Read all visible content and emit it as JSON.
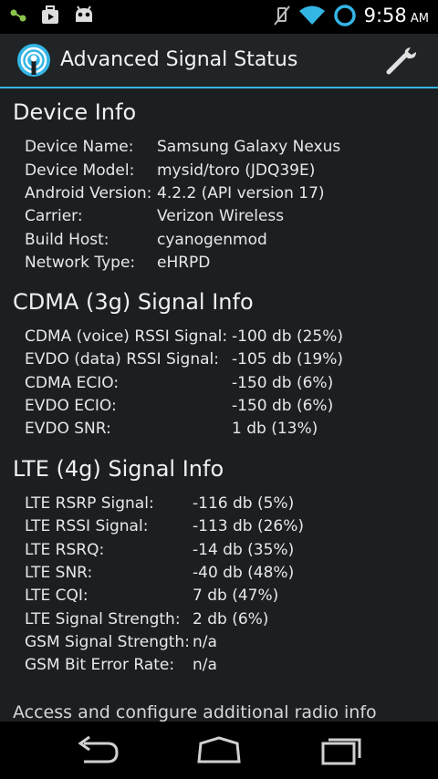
{
  "statusbar": {
    "time": "9:58",
    "ampm": "AM",
    "icons": [
      "voicemail-icon",
      "play-store-icon",
      "android-icon",
      "vibrate-off-icon",
      "wifi-icon",
      "ring-icon",
      "battery-icon"
    ]
  },
  "actionbar": {
    "title": "Advanced Signal Status",
    "settings_icon": "wrench-icon"
  },
  "device_info": {
    "title": "Device Info",
    "rows": [
      {
        "label": "Device Name:",
        "value": "Samsung Galaxy Nexus"
      },
      {
        "label": "Device Model:",
        "value": "mysid/toro (JDQ39E)"
      },
      {
        "label": "Android Version:",
        "value": "4.2.2 (API version 17)"
      },
      {
        "label": "Carrier:",
        "value": "Verizon Wireless"
      },
      {
        "label": "Build Host:",
        "value": "cyanogenmod"
      },
      {
        "label": "Network Type:",
        "value": "eHRPD"
      }
    ]
  },
  "cdma_info": {
    "title": "CDMA (3g) Signal Info",
    "rows": [
      {
        "label": "CDMA (voice) RSSI Signal:",
        "value": "-100 db (25%)"
      },
      {
        "label": "EVDO (data) RSSI Signal:",
        "value": "-105 db (19%)"
      },
      {
        "label": "CDMA ECIO:",
        "value": "-150 db (6%)"
      },
      {
        "label": "EVDO ECIO:",
        "value": "-150 db (6%)"
      },
      {
        "label": "EVDO SNR:",
        "value": "1 db (13%)"
      }
    ]
  },
  "lte_info": {
    "title": "LTE (4g) Signal Info",
    "rows": [
      {
        "label": "LTE RSRP Signal:",
        "value": "-116 db (5%)"
      },
      {
        "label": "LTE RSSI Signal:",
        "value": "-113 db (26%)"
      },
      {
        "label": "LTE RSRQ:",
        "value": "-14 db (35%)"
      },
      {
        "label": "LTE SNR:",
        "value": "-40 db (48%)"
      },
      {
        "label": "LTE CQI:",
        "value": "7 db (47%)"
      },
      {
        "label": "LTE Signal Strength:",
        "value": "2 db (6%)"
      },
      {
        "label": "GSM Signal Strength:",
        "value": "n/a"
      },
      {
        "label": "GSM Bit Error Rate:",
        "value": "n/a"
      }
    ]
  },
  "footer": {
    "text": "Access and configure additional radio info"
  },
  "navbar": {
    "back": "back-icon",
    "home": "home-icon",
    "recents": "recents-icon"
  }
}
